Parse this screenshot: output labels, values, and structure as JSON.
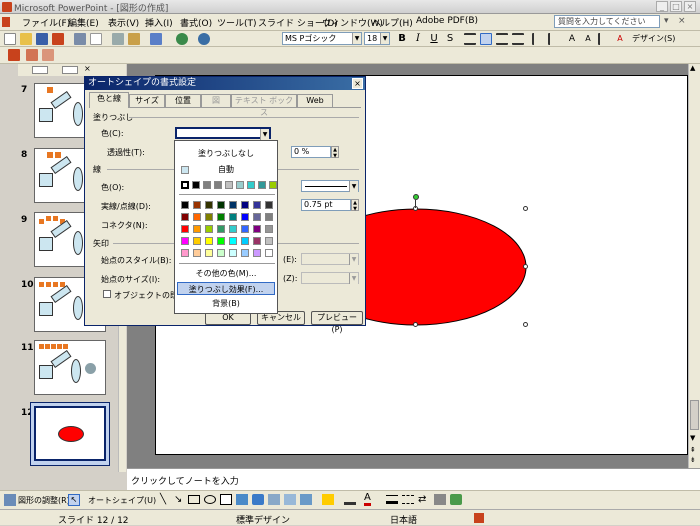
{
  "window": {
    "title": "Microsoft PowerPoint - [図形の作成]"
  },
  "menu": {
    "items": [
      "ファイル(F)",
      "編集(E)",
      "表示(V)",
      "挿入(I)",
      "書式(O)",
      "ツール(T)",
      "スライド ショー(D)",
      "ウィンドウ(W)",
      "ヘルプ(H)",
      "Adobe PDF(B)"
    ],
    "help_placeholder": "質問を入力してください"
  },
  "toolbar": {
    "font_name": "MS Pゴシック",
    "font_size": "18",
    "design_label": "デザイン(S)"
  },
  "slides_panel": {
    "numbers": [
      "7",
      "8",
      "9",
      "10",
      "11",
      "12"
    ],
    "selected": "12"
  },
  "notes": {
    "placeholder": "クリックしてノートを入力"
  },
  "drawbar": {
    "draw_label": "図形の調整(R)",
    "autoshape_label": "オートシェイプ(U)"
  },
  "status": {
    "slide": "スライド 12 / 12",
    "design": "標準デザイン",
    "language": "日本語"
  },
  "dialog": {
    "title": "オートシェイプの書式設定",
    "tabs": [
      "色と線",
      "サイズ",
      "位置",
      "図",
      "テキスト ボックス",
      "Web"
    ],
    "fill_section": "塗りつぶし",
    "color_label": "色(C):",
    "transparency_label": "透過性(T):",
    "transparency_value": "0 %",
    "line_section": "線",
    "line_color_label": "色(O):",
    "line_style_label": "実線/点線(D):",
    "connector_label": "コネクタ(N):",
    "line_weight_value": "0.75 pt",
    "arrow_section": "矢印",
    "begin_style_label": "始点のスタイル(B):",
    "begin_size_label": "始点のサイズ(I):",
    "end_style_suffix": "(E):",
    "end_size_suffix": "(Z):",
    "default_checkbox_label": "オブジェクトの既定",
    "ok": "OK",
    "cancel": "キャンセル",
    "preview": "プレビュー(P)"
  },
  "color_popup": {
    "no_fill": "塗りつぶしなし",
    "auto": "自動",
    "more_colors": "その他の色(M)...",
    "fill_effects": "塗りつぶし効果(F)...",
    "background": "背景(B)",
    "recent_colors": [
      "#ffffff",
      "#000000",
      "#808080",
      "#808080",
      "#c0c0c0",
      "#99cccc",
      "#33cccc",
      "#339999",
      "#99cc00"
    ],
    "palette": [
      [
        "#000000",
        "#993300",
        "#333300",
        "#003300",
        "#003366",
        "#000080",
        "#333399",
        "#333333"
      ],
      [
        "#800000",
        "#ff6600",
        "#808000",
        "#008000",
        "#008080",
        "#0000ff",
        "#666699",
        "#808080"
      ],
      [
        "#ff0000",
        "#ff9900",
        "#99cc00",
        "#339966",
        "#33cccc",
        "#3366ff",
        "#800080",
        "#969696"
      ],
      [
        "#ff00ff",
        "#ffcc00",
        "#ffff00",
        "#00ff00",
        "#00ffff",
        "#00ccff",
        "#993366",
        "#c0c0c0"
      ],
      [
        "#ff99cc",
        "#ffcc99",
        "#ffff99",
        "#ccffcc",
        "#ccffff",
        "#99ccff",
        "#cc99ff",
        "#ffffff"
      ]
    ]
  },
  "colors": {
    "shape_fill": "#ff0000",
    "thumb_shape": "#e87722",
    "thumb_blue": "#cce6f0"
  }
}
